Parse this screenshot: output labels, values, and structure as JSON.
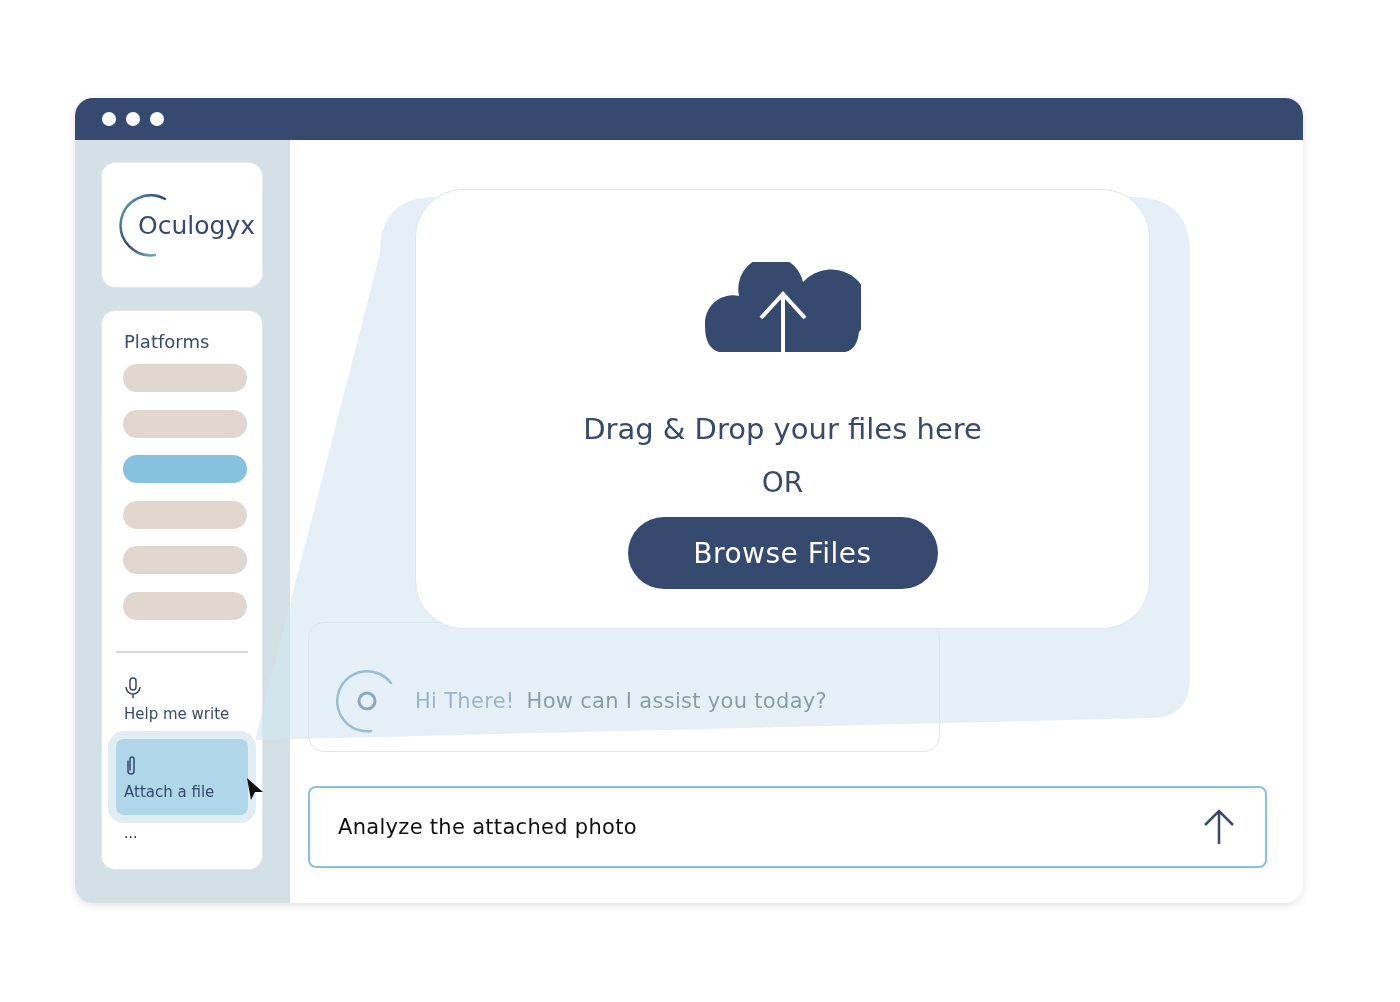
{
  "sidebar": {
    "logo": "Oculogyx",
    "section_title": "Platforms",
    "platforms": [
      {
        "selected": false
      },
      {
        "selected": false
      },
      {
        "selected": true
      },
      {
        "selected": false
      },
      {
        "selected": false
      },
      {
        "selected": false
      }
    ],
    "tools": [
      {
        "kind": "mic",
        "label": "Help me write",
        "selected": false
      },
      {
        "kind": "attach",
        "label": "Attach a file",
        "selected": true
      }
    ],
    "more": "..."
  },
  "upload": {
    "title": "Drag & Drop your files here",
    "separator": "OR",
    "button": "Browse Files"
  },
  "chat": {
    "greeting": "Hi There!",
    "message": "How can I assist you today?"
  },
  "prompt": {
    "value": "Analyze the attached photo"
  }
}
